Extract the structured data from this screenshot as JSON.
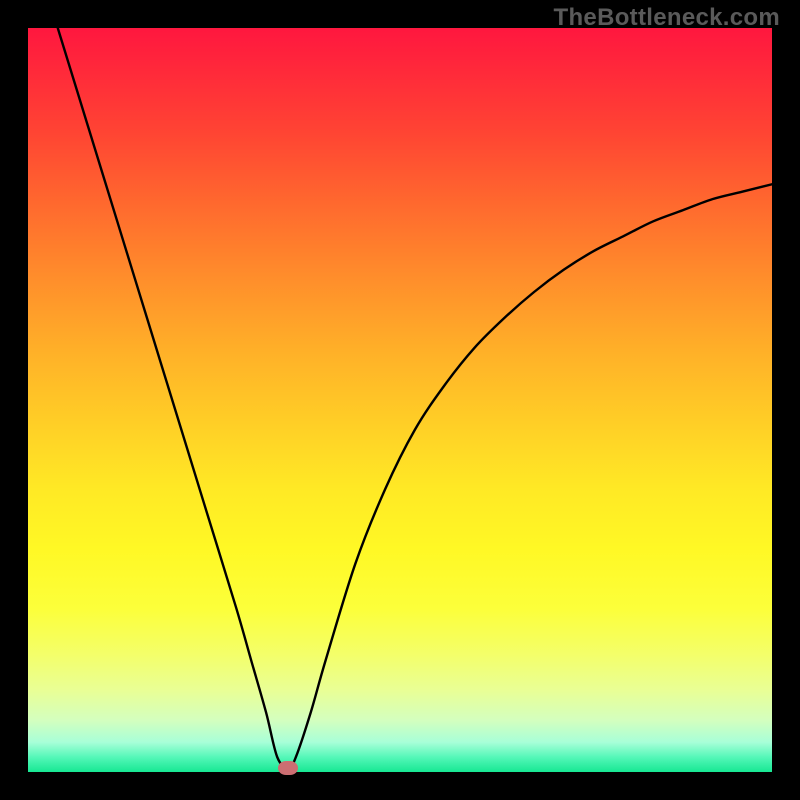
{
  "watermark": "TheBottleneck.com",
  "chart_data": {
    "type": "line",
    "title": "",
    "xlabel": "",
    "ylabel": "",
    "xlim": [
      0,
      100
    ],
    "ylim": [
      0,
      100
    ],
    "grid": false,
    "series": [
      {
        "name": "bottleneck-curve",
        "x": [
          4,
          8,
          12,
          16,
          20,
          24,
          28,
          30,
          32,
          33.5,
          35,
          36,
          38,
          40,
          44,
          48,
          52,
          56,
          60,
          64,
          68,
          72,
          76,
          80,
          84,
          88,
          92,
          96,
          100
        ],
        "y": [
          100,
          87,
          74,
          61,
          48,
          35,
          22,
          15,
          8,
          2,
          0.5,
          2,
          8,
          15,
          28,
          38,
          46,
          52,
          57,
          61,
          64.5,
          67.5,
          70,
          72,
          74,
          75.5,
          77,
          78,
          79
        ]
      }
    ],
    "marker": {
      "x": 35,
      "y": 0.5,
      "name": "optimum-point"
    },
    "colors": {
      "curve": "#000000",
      "marker": "#cc6e72",
      "frame": "#000000"
    }
  }
}
